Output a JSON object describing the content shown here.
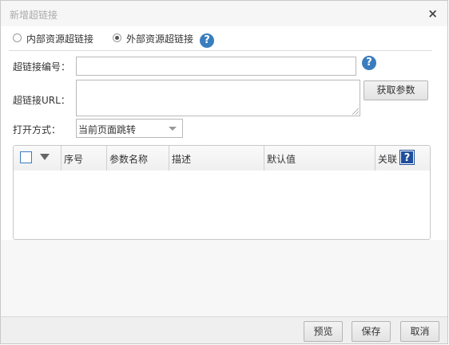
{
  "dialog": {
    "title": "新增超链接",
    "close_glyph": "×"
  },
  "link_type": {
    "options": [
      {
        "label": "内部资源超链接",
        "checked": false
      },
      {
        "label": "外部资源超链接",
        "checked": true
      }
    ],
    "help_glyph": "?"
  },
  "form": {
    "code_label": "超链接编号：",
    "code_value": "",
    "url_label": "超链接URL：",
    "url_value": "",
    "fetch_params_button": "获取参数",
    "open_mode_label": "打开方式：",
    "open_mode_value": "当前页面跳转"
  },
  "params_table": {
    "columns": [
      "序号",
      "参数名称",
      "描述",
      "默认值",
      "关联"
    ],
    "help_glyph": "?",
    "rows": []
  },
  "footer": {
    "preview_button": "预览",
    "save_button": "保存",
    "cancel_button": "取消"
  },
  "icons": {
    "help": "question-circle-icon",
    "close": "close-icon",
    "dropdown": "chevron-down-icon",
    "sort": "triangle-down-icon"
  },
  "colors": {
    "accent": "#3a7dbf",
    "help_square": "#1f4e9c"
  }
}
